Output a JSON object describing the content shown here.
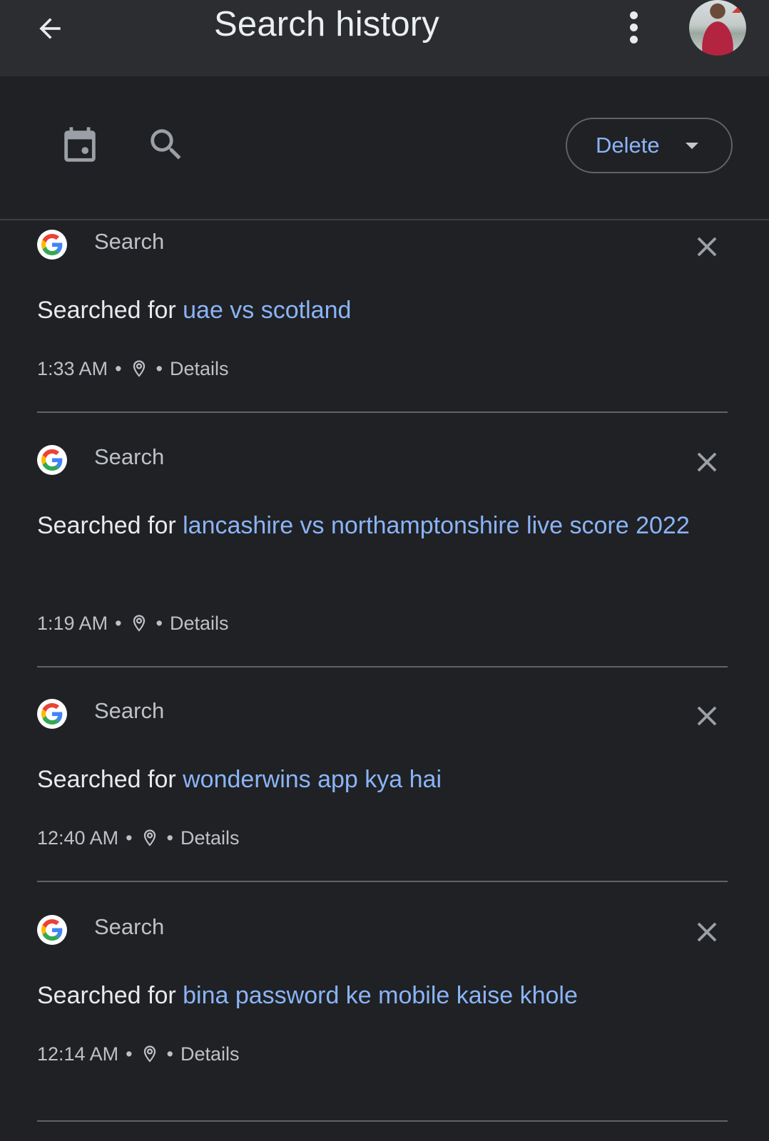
{
  "appbar": {
    "title": "Search history",
    "back_icon": "arrow-back-icon",
    "more_icon": "more-vert-icon",
    "avatar": "account-avatar"
  },
  "toolbar": {
    "calendar_icon": "calendar-icon",
    "search_icon": "search-icon",
    "delete_label": "Delete",
    "delete_caret_icon": "arrow-drop-down-icon"
  },
  "colors": {
    "background": "#202124",
    "appbar": "#2c2d30",
    "link": "#8ab4f8",
    "text": "#e8eaed",
    "secondary": "#bdc1c6"
  },
  "entries": [
    {
      "product": "Search",
      "prefix": "Searched for ",
      "query": "uae vs scotland",
      "time": "1:33 AM",
      "sep": "•",
      "details": "Details"
    },
    {
      "product": "Search",
      "prefix": "Searched for ",
      "query": "lancashire vs northamptonshire live score 2022",
      "time": "1:19 AM",
      "sep": "•",
      "details": "Details"
    },
    {
      "product": "Search",
      "prefix": "Searched for ",
      "query": "wonderwins app kya hai",
      "time": "12:40 AM",
      "sep": "•",
      "details": "Details"
    },
    {
      "product": "Search",
      "prefix": "Searched for ",
      "query": "bina password ke mobile kaise khole",
      "time": "12:14 AM",
      "sep": "•",
      "details": "Details"
    }
  ]
}
